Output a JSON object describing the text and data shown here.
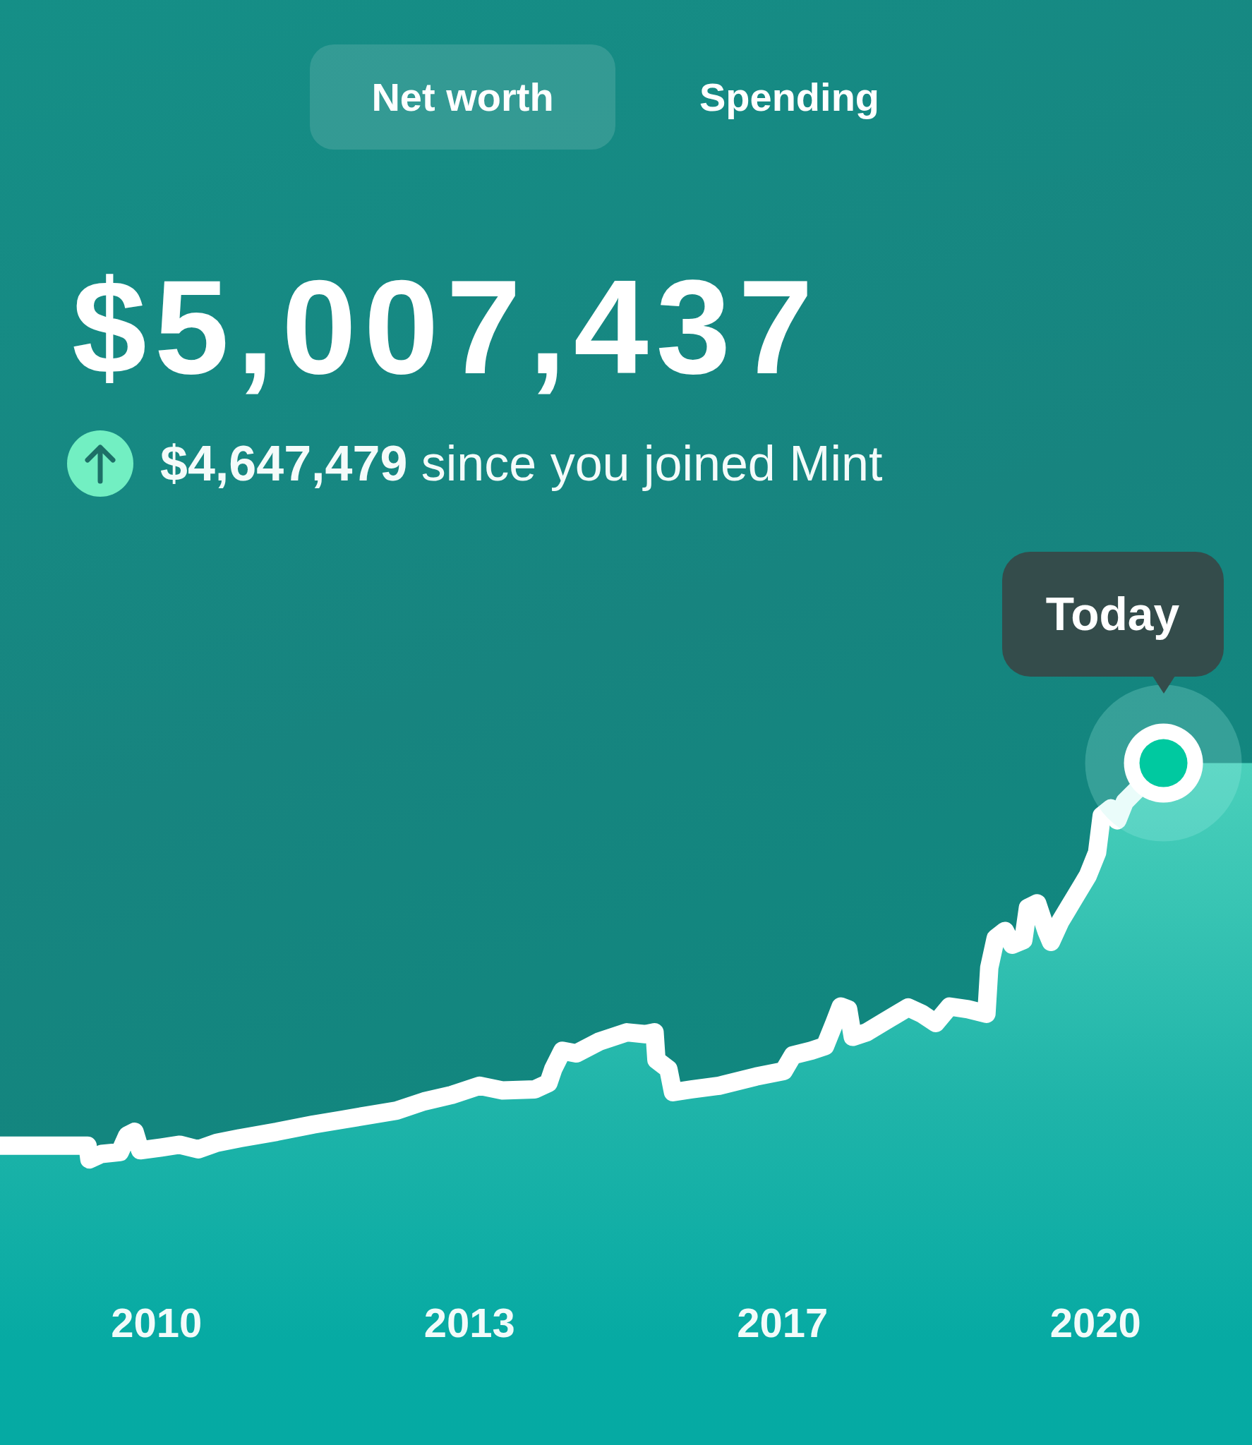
{
  "tabs": [
    {
      "label": "Net worth",
      "selected": true
    },
    {
      "label": "Spending",
      "selected": false
    }
  ],
  "net_worth": {
    "amount": "$5,007,437",
    "increase": true,
    "change": "**$4,647,479** since you joined Mint"
  },
  "chart": {
    "tooltip": "Today",
    "x_labels": [
      "2010",
      "2013",
      "2017",
      "2020"
    ]
  }
}
